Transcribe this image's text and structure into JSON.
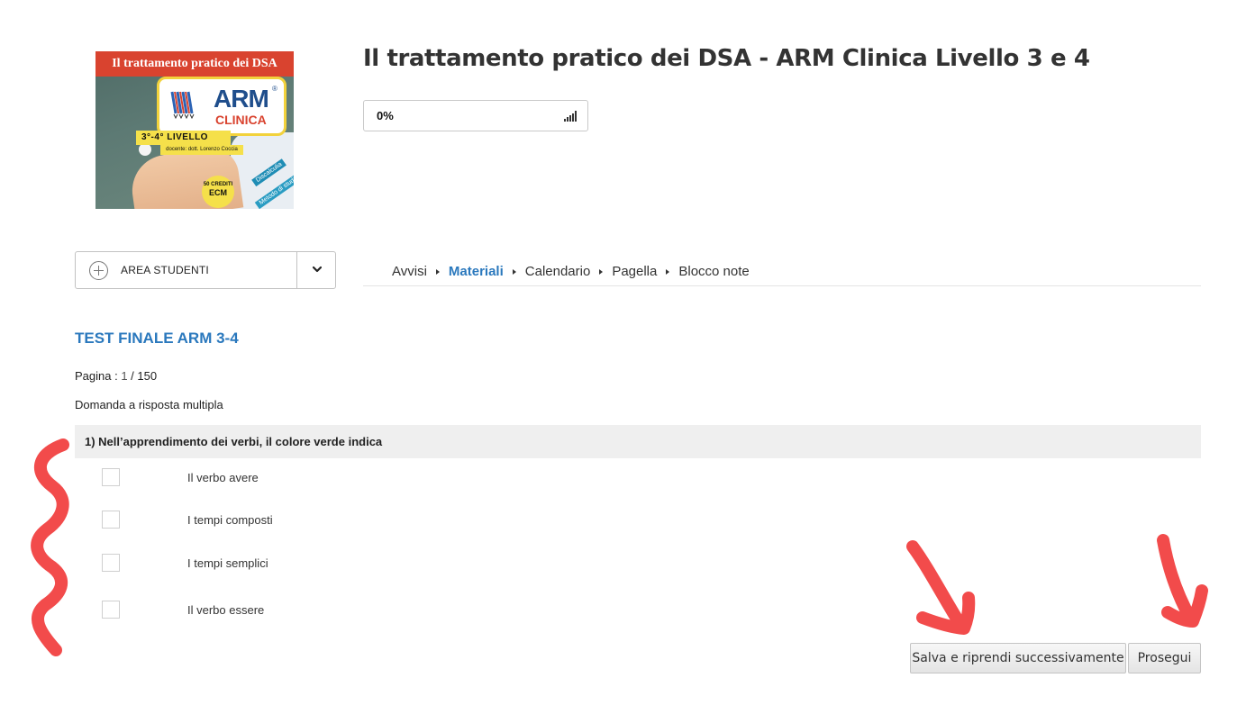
{
  "course": {
    "cover": {
      "banner": "Il trattamento pratico dei DSA",
      "logo_main": "ARM",
      "logo_reg": "®",
      "logo_sub": "CLINICA",
      "level": "3°-4° LIVELLO",
      "teacher": "docente: dott. Lorenzo Coccia",
      "badge_top": "50 CREDITI",
      "badge_main": "ECM",
      "tag_1": "Discalculia",
      "tag_2": "Metodo di studio"
    },
    "title": "Il trattamento pratico dei DSA - ARM Clinica Livello 3 e 4",
    "progress": "0%"
  },
  "area_studenti": {
    "label": "AREA STUDENTI"
  },
  "tabs": [
    {
      "label": "Avvisi",
      "active": false
    },
    {
      "label": "Materiali",
      "active": true
    },
    {
      "label": "Calendario",
      "active": false
    },
    {
      "label": "Pagella",
      "active": false
    },
    {
      "label": "Blocco note",
      "active": false
    }
  ],
  "test": {
    "title": "TEST FINALE ARM 3-4",
    "page_label": "Pagina : ",
    "page_current": "1",
    "page_total": " / 150",
    "question_type": "Domanda a risposta multipla",
    "question": "1) Nell’apprendimento dei verbi, il colore verde indica",
    "options": [
      "Il verbo avere",
      "I tempi composti",
      "I tempi semplici",
      "Il verbo essere"
    ]
  },
  "buttons": {
    "save_label": "Salva e riprendi successivamente",
    "next_label": "Prosegui"
  },
  "colors": {
    "accent": "#2a78bd",
    "annotation": "#f24b4b"
  }
}
